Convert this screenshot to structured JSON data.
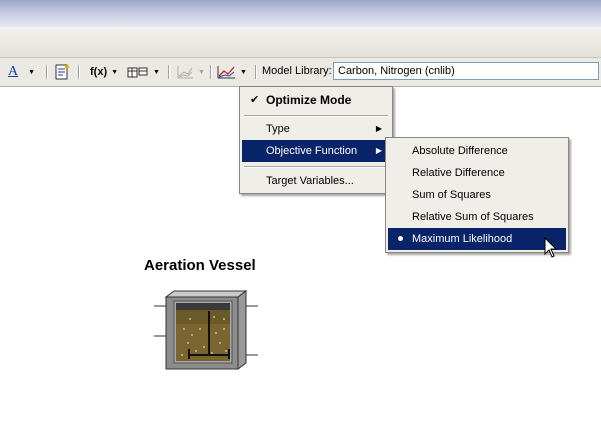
{
  "toolbar": {
    "text_color_icon": "A",
    "fx_label": "f(x)",
    "model_library_label": "Model Library:",
    "model_library_value": "Carbon, Nitrogen (cnlib)"
  },
  "context_menu": {
    "optimize_mode": "Optimize Mode",
    "optimize_check": "✔",
    "type": "Type",
    "objective_function": "Objective Function",
    "target_variables": "Target Variables..."
  },
  "submenu": {
    "items": [
      "Absolute Difference",
      "Relative Difference",
      "Sum of Squares",
      "Relative Sum of Squares",
      "Maximum Likelihood"
    ],
    "selected_index": 4
  },
  "canvas": {
    "object_title": "Aeration Vessel"
  },
  "colors": {
    "menu_highlight": "#0a246a",
    "menu_bg": "#f0eee8",
    "toolbar_bg": "#ebe9e3"
  }
}
